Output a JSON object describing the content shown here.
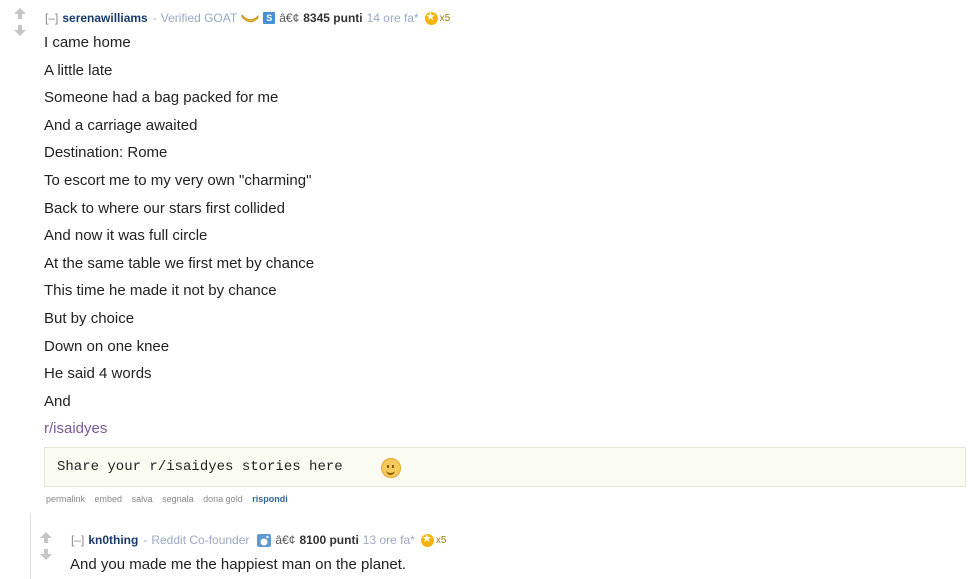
{
  "comment": {
    "expand": "[–]",
    "author": "serenawilliams",
    "separator": "-",
    "flair": "Verified GOAT",
    "badge_letter": "S",
    "bullet": "â€¢",
    "score": "8345 punti",
    "time": "14 ore fa*",
    "gold_count": "x5",
    "lines": [
      "I came home",
      "A little late",
      "Someone had a bag packed for me",
      "And a carriage awaited",
      "Destination: Rome",
      "To escort me to my very own \"charming\"",
      "Back to where our stars first collided",
      "And now it was full circle",
      "At the same table we first met by chance",
      "This time he made it not by chance",
      "But by choice",
      "Down on one knee",
      "He said 4 words",
      "And"
    ],
    "subreddit_link": "r/isaidyes",
    "code_text": "Share your r/isaidyes stories here",
    "buttons": {
      "permalink": "permalink",
      "embed": "embed",
      "save": "salva",
      "report": "segnala",
      "give_gold": "dona gold",
      "reply": "rispondi"
    }
  },
  "reply": {
    "expand": "[–]",
    "author": "kn0thing",
    "separator": "-",
    "flair": "Reddit Co-founder",
    "bullet": "â€¢",
    "score": "8100 punti",
    "time": "13 ore fa*",
    "gold_count": "x5",
    "text": "And you made me the happiest man on the planet."
  },
  "colors": {
    "author": "#1a3a6b",
    "flair": "#9aa9c4",
    "gold": "#f5b400",
    "subreddit_link": "#7a5a9a",
    "reply_button": "#336699",
    "code_box_bg": "#fbfcf1"
  }
}
